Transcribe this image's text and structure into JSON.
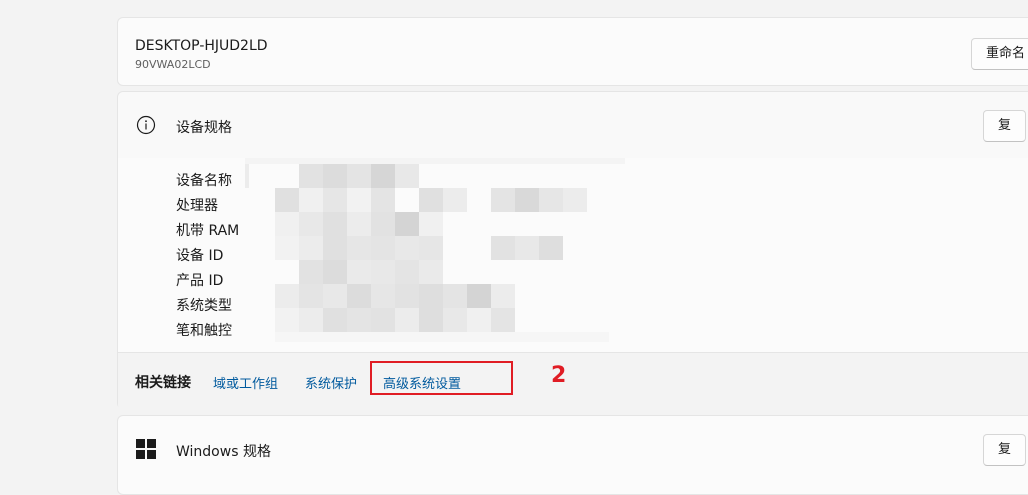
{
  "device": {
    "name": "DESKTOP-HJUD2LD",
    "model": "90VWA02LCD",
    "rename_label": "重命名"
  },
  "specs": {
    "title": "设备规格",
    "copy_label": "复",
    "labels": [
      "设备名称",
      "处理器",
      "机带 RAM",
      "设备 ID",
      "产品 ID",
      "系统类型",
      "笔和触控"
    ]
  },
  "related": {
    "title": "相关链接",
    "links": [
      "域或工作组",
      "系统保护",
      "高级系统设置"
    ],
    "step": "2",
    "highlight_color": "#e01c24"
  },
  "windows": {
    "title": "Windows 规格",
    "copy_label": "复"
  },
  "icons": {
    "specs": "info-icon",
    "windows": "windows-logo-icon"
  },
  "colors": {
    "link": "#005a9e",
    "background": "#f3f3f3",
    "card": "#fbfbfb"
  }
}
